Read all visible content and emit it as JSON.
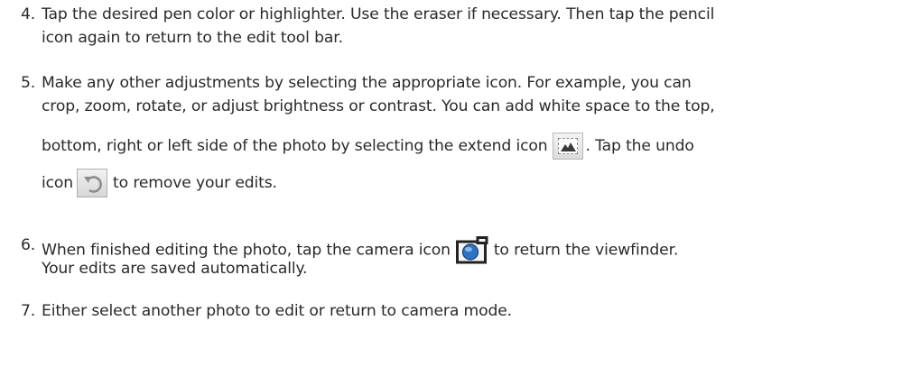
{
  "steps": [
    {
      "number": "4.",
      "lines": [
        "Tap the desired pen color or highlighter. Use the eraser if necessary. Then tap the pencil",
        "icon again to return to the edit tool bar."
      ]
    },
    {
      "number": "5.",
      "line1": "Make any other adjustments by selecting the appropriate icon. For example, you can",
      "line2": "crop, zoom, rotate, or adjust brightness or contrast. You can add white space to the top,",
      "line3_pre": "bottom, right or left side of the photo by selecting the extend icon",
      "line3_post": ". Tap the undo",
      "line4_pre": "icon",
      "line4_post": "to remove your edits."
    },
    {
      "number": "6.",
      "line1_pre": "When finished editing the photo, tap the camera icon",
      "line1_post": "to return the viewfinder.",
      "line2": "Your edits are saved automatically."
    },
    {
      "number": "7.",
      "line1": "Either select another photo to edit or return to camera mode."
    }
  ],
  "icons": {
    "extend": "extend-icon",
    "undo": "undo-icon",
    "camera": "camera-icon"
  },
  "colors": {
    "text": "#2a2a2a",
    "camera_blue": "#1f5fa8"
  }
}
